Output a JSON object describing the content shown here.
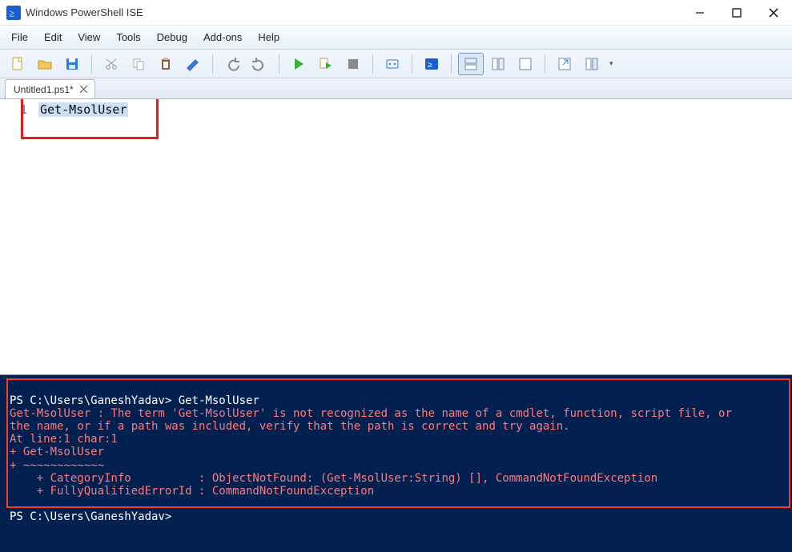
{
  "window": {
    "title": "Windows PowerShell ISE"
  },
  "menu": {
    "items": [
      "File",
      "Edit",
      "View",
      "Tools",
      "Debug",
      "Add-ons",
      "Help"
    ]
  },
  "tabs": {
    "active": {
      "label": "Untitled1.ps1*"
    }
  },
  "editor": {
    "line_number": "1",
    "code": "Get-MsolUser"
  },
  "console": {
    "prompt1": "PS C:\\Users\\GaneshYadav> Get-MsolUser",
    "err1": "Get-MsolUser : The term 'Get-MsolUser' is not recognized as the name of a cmdlet, function, script file, or",
    "err2": "the name, or if a path was included, verify that the path is correct and try again.",
    "err3": "At line:1 char:1",
    "err4": "+ Get-MsolUser",
    "err5": "+ ~~~~~~~~~~~~",
    "err6": "    + CategoryInfo          : ObjectNotFound: (Get-MsolUser:String) [], CommandNotFoundException",
    "err7": "    + FullyQualifiedErrorId : CommandNotFoundException",
    "prompt2": "PS C:\\Users\\GaneshYadav>"
  }
}
